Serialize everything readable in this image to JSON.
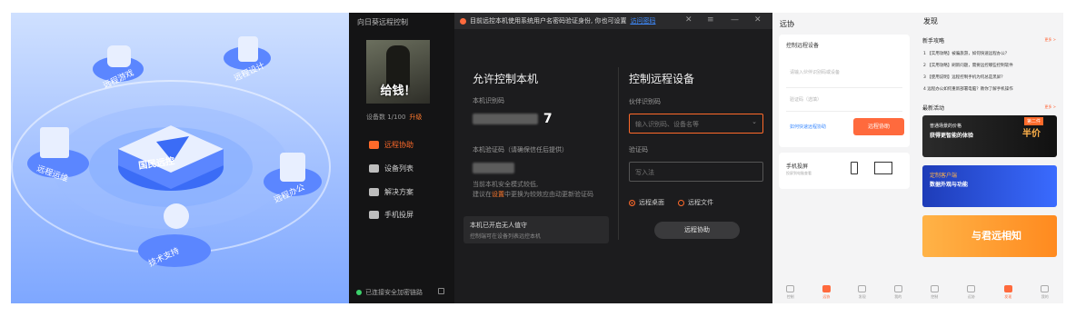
{
  "panel1": {
    "center_label": "国民远控",
    "nodes": [
      "远程游戏",
      "远程设计",
      "远程运维",
      "远程办公",
      "技术支持"
    ]
  },
  "panel2": {
    "app_title": "向日葵远程控制",
    "avatar_caption": "给钱！",
    "device_info": "设备数 1/100",
    "upgrade": "升级",
    "nav": [
      "远程协助",
      "设备列表",
      "解决方案",
      "手机投屏"
    ],
    "connection": "已连接安全加密链路",
    "notice_text": "目前远控本机使用系统用户名密码验证身份, 你也可设置",
    "notice_link": "访问密码",
    "allow_title": "允许控制本机",
    "id_label": "本机识别码",
    "id_suffix": "7",
    "code_label": "本机验证码（请确保信任后提供）",
    "tip_line1": "当前本机安全模式较低,",
    "tip_line2a": "建议在",
    "tip_link": "设置",
    "tip_line2b": "中更换为较效应由动更新验证码",
    "unattended_title": "本机已开启无人值守",
    "unattended_desc": "控制端可在设备列表远控本机",
    "control_title": "控制远程设备",
    "partner_label": "伙伴识别码",
    "partner_placeholder": "输入识别码、设备名等",
    "verify_label": "验证码",
    "verify_placeholder": "写入法",
    "radio_desktop": "远程桌面",
    "radio_files": "远程文件",
    "assist_button": "远程协助"
  },
  "panel3": {
    "title": "远协",
    "card_title": "控制远程设备",
    "field1_placeholder": "请输入伙伴识别码或设备",
    "field2_placeholder": "验证码（选填）",
    "link_text": "如何快速远程协助",
    "button": "远程协助",
    "cast_title": "手机投屏",
    "cast_desc": "投屏到电脑查看",
    "tabs": [
      "控制",
      "远协",
      "发现",
      "我的"
    ]
  },
  "panel4": {
    "title": "发现",
    "sec1": "新手攻略",
    "more": "更多 >",
    "items": [
      "1 【实用攻略】被骗旅游，如何快速远程办公？",
      "2 【实用攻略】刷新问题，需要远控哪些控制软件",
      "3 【使用说明】远程控制手机为何总是黑屏？",
      "4 远程办公如何重新部署电脑？教你了解手机操作"
    ],
    "sec2": "最新活动",
    "banner1_title": "普通场景的价格",
    "banner1_sub": "获得更智能的体验",
    "banner1_badge": "第二件",
    "banner1_badge2": "半价",
    "banner2_title": "定制客户端",
    "banner2_sub": "数据外观与功能",
    "banner3_title": "与君远相知",
    "tabs": [
      "控制",
      "远协",
      "发现",
      "我的"
    ]
  },
  "colors": {
    "accent": "#ff6a2a",
    "link": "#3f8cff",
    "dark_bg": "#1c1c1e",
    "illus_blue": "#3b6cf6"
  }
}
